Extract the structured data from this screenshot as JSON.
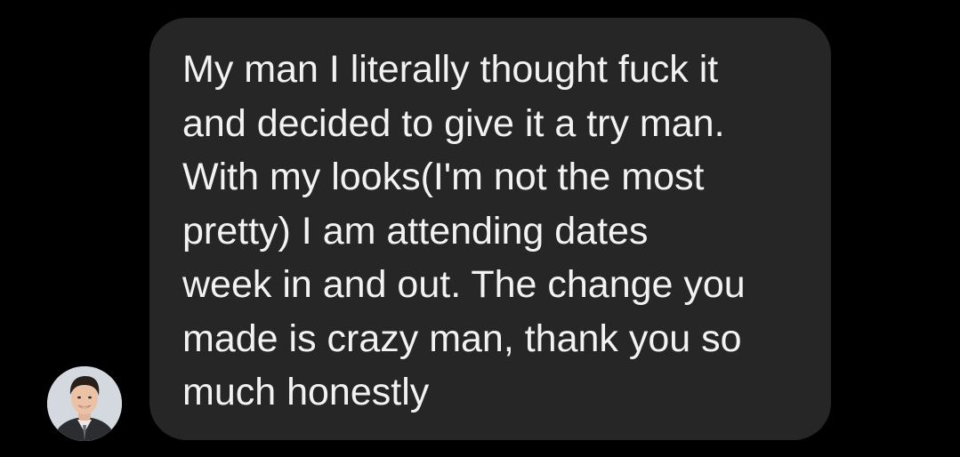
{
  "colors": {
    "background": "#000000",
    "bubble": "#262626",
    "text": "#f2f2f2"
  },
  "avatar": {
    "icon": "user-profile-photo"
  },
  "message": {
    "text": "My man I literally thought fuck it\nand decided to give it a try man.\nWith my looks(I'm not the most\npretty) I am attending dates\nweek in and out. The change you\nmade is crazy man, thank you so\nmuch honestly"
  }
}
